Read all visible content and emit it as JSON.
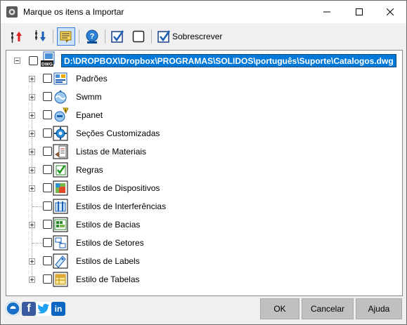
{
  "window": {
    "title": "Marque os itens a Importar"
  },
  "toolbar": {
    "overwrite_label": "Sobrescrever",
    "overwrite_checked": true,
    "icons": [
      "move-up-icon",
      "move-down-icon",
      "notes-icon",
      "help-icon",
      "check-all-icon",
      "uncheck-all-icon",
      "overwrite-checkbox"
    ]
  },
  "tree": {
    "root": {
      "label": "D:\\DROPBOX\\Dropbox\\PROGRAMAS\\SOLIDOS\\português\\Suporte\\Catalogos.dwg",
      "checked": false,
      "expanded": true
    },
    "items": [
      {
        "label": "Padrões",
        "icon": "settings-grid-icon",
        "expandable": true
      },
      {
        "label": "Swmm",
        "icon": "swmm-icon",
        "expandable": true
      },
      {
        "label": "Epanet",
        "icon": "epanet-icon",
        "expandable": true
      },
      {
        "label": "Seções Customizadas",
        "icon": "gear-icon",
        "expandable": true
      },
      {
        "label": "Listas de Materiais",
        "icon": "materials-list-icon",
        "expandable": true
      },
      {
        "label": "Regras",
        "icon": "rules-check-icon",
        "expandable": true
      },
      {
        "label": "Estilos de Dispositivos",
        "icon": "device-styles-icon",
        "expandable": true
      },
      {
        "label": "Estilos de Interferências",
        "icon": "interference-styles-icon",
        "expandable": false
      },
      {
        "label": "Estilos de Bacias",
        "icon": "basin-styles-icon",
        "expandable": true
      },
      {
        "label": "Estilos de Setores",
        "icon": "sector-styles-icon",
        "expandable": false
      },
      {
        "label": "Estilos de Labels",
        "icon": "label-styles-icon",
        "expandable": true
      },
      {
        "label": "Estilo de Tabelas",
        "icon": "table-styles-icon",
        "expandable": true
      }
    ]
  },
  "footer": {
    "social": [
      "app-logo-icon",
      "facebook-icon",
      "twitter-icon",
      "linkedin-icon"
    ],
    "social_glyphs": {
      "facebook": "f",
      "linkedin": "in"
    },
    "ok_label": "OK",
    "cancel_label": "Cancelar",
    "help_label": "Ajuda"
  },
  "colors": {
    "selection": "#0078d7",
    "button_face": "#c0c0c0",
    "accent_blue": "#1a5fb4"
  }
}
